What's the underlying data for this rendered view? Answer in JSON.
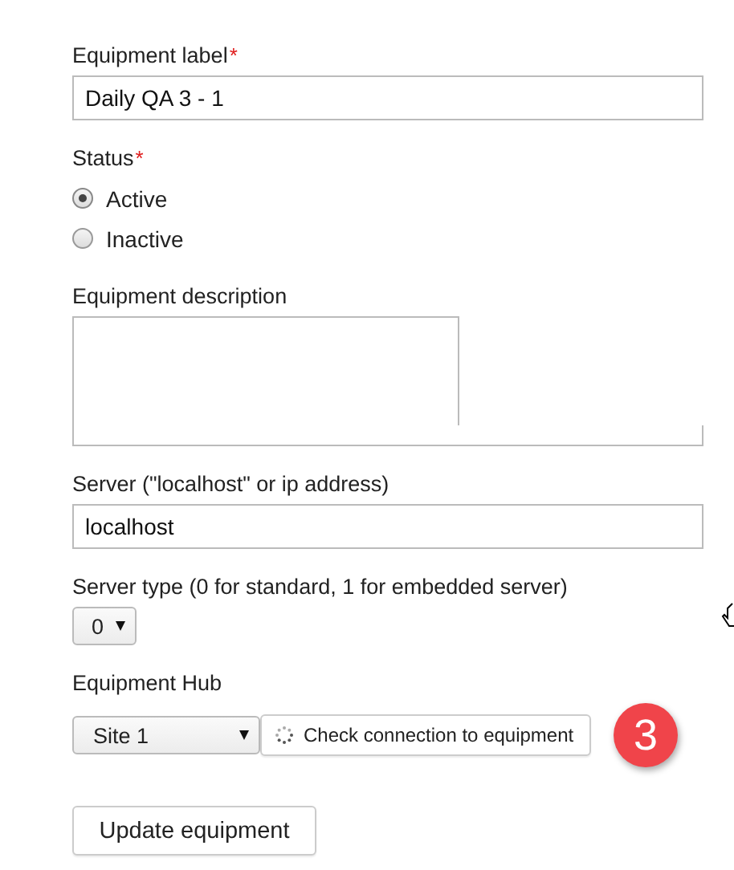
{
  "equipment_label": {
    "label": "Equipment label",
    "required_mark": "*",
    "value": "Daily QA 3 - 1"
  },
  "status": {
    "label": "Status",
    "required_mark": "*",
    "options": [
      {
        "label": "Active",
        "selected": true
      },
      {
        "label": "Inactive",
        "selected": false
      }
    ]
  },
  "description": {
    "label": "Equipment description"
  },
  "server": {
    "label": "Server (\"localhost\" or ip address)",
    "value": "localhost"
  },
  "server_type": {
    "label": "Server type (0 for standard, 1 for embedded server)",
    "value": "0"
  },
  "hub": {
    "label": "Equipment Hub",
    "value": "Site 1",
    "check_button": "Check connection to equipment"
  },
  "step_badge": "3",
  "submit": "Update equipment"
}
